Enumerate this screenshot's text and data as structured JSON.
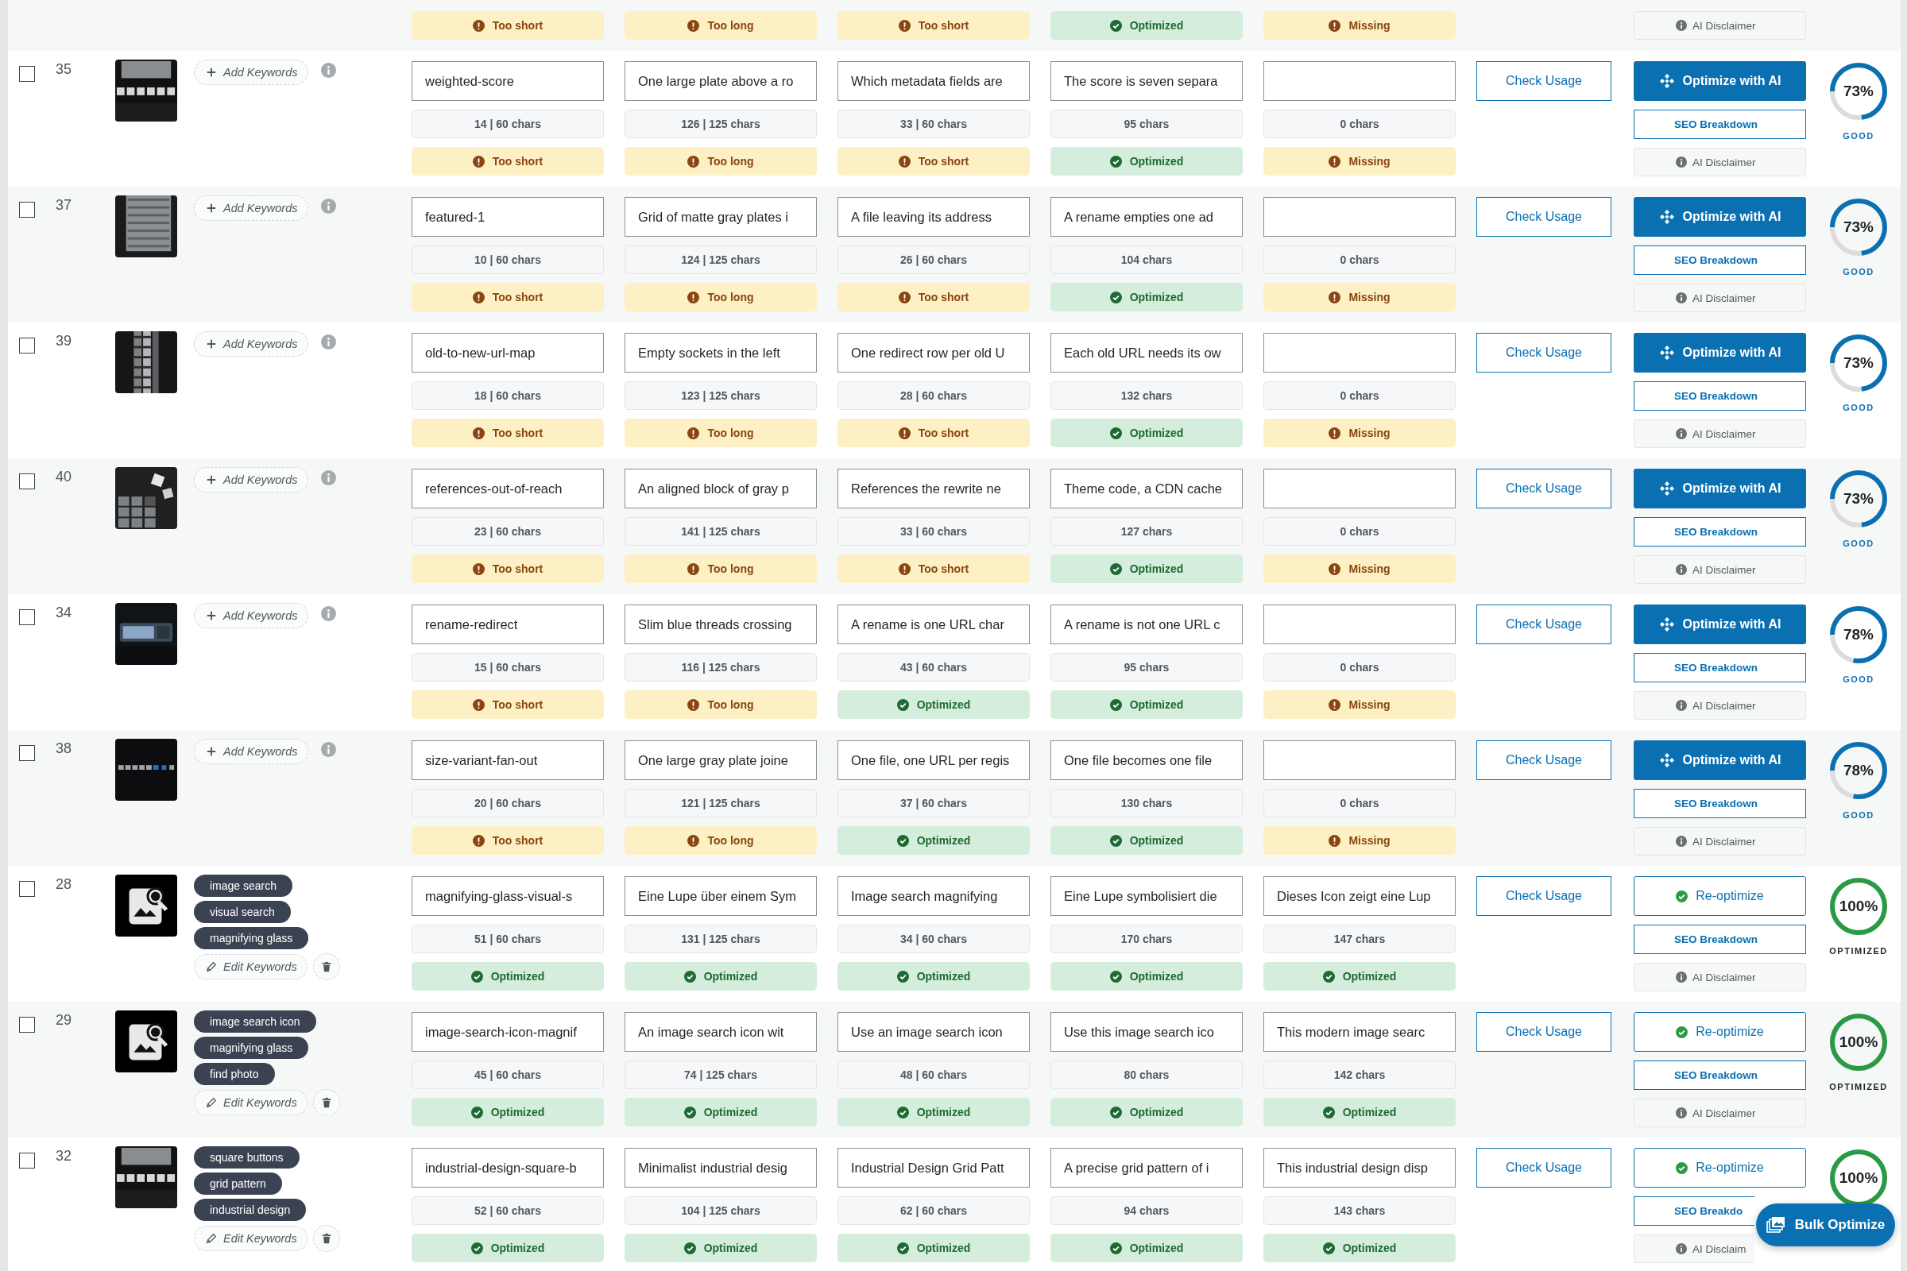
{
  "rows": [
    {
      "kind": "clipped",
      "fields": [
        {
          "status": {
            "kind": "warning",
            "text": "Too short"
          }
        },
        {
          "status": {
            "kind": "warning",
            "text": "Too long"
          }
        },
        {
          "status": {
            "kind": "warning",
            "text": "Too short"
          }
        },
        {
          "status": {
            "kind": "ok",
            "text": "Optimized"
          }
        },
        {
          "status": {
            "kind": "warning",
            "text": "Missing"
          }
        }
      ],
      "disclaimer": "AI Disclaimer"
    },
    {
      "kind": "full",
      "selected": false,
      "id": "35",
      "keywords": [],
      "keyword_action": "Add Keywords",
      "fields": [
        {
          "value": "weighted-score",
          "count": "14 | 60 chars",
          "status": {
            "kind": "warning",
            "text": "Too short"
          }
        },
        {
          "value": "One large plate above a ro",
          "count": "126 | 125 chars",
          "status": {
            "kind": "warning",
            "text": "Too long"
          }
        },
        {
          "value": "Which metadata fields are",
          "count": "33 | 60 chars",
          "status": {
            "kind": "warning",
            "text": "Too short"
          }
        },
        {
          "value": "The score is seven separa",
          "count": "95 chars",
          "status": {
            "kind": "ok",
            "text": "Optimized"
          }
        },
        {
          "count": "0 chars",
          "status": {
            "kind": "warning",
            "text": "Missing"
          }
        }
      ],
      "check_usage": "Check Usage",
      "optimize": {
        "kind": "ai",
        "label": "Optimize with AI"
      },
      "seo": "SEO Breakdown",
      "disclaimer": "AI Disclaimer",
      "score": {
        "kind": "good",
        "level": 0.73,
        "text": "73%",
        "label": "GOOD"
      }
    },
    {
      "kind": "full",
      "selected": false,
      "id": "37",
      "keywords": [],
      "keyword_action": "Add Keywords",
      "fields": [
        {
          "value": "featured-1",
          "count": "10 | 60 chars",
          "status": {
            "kind": "warning",
            "text": "Too short"
          }
        },
        {
          "value": "Grid of matte gray plates i",
          "count": "124 | 125 chars",
          "status": {
            "kind": "warning",
            "text": "Too long"
          }
        },
        {
          "value": "A file leaving its address",
          "count": "26 | 60 chars",
          "status": {
            "kind": "warning",
            "text": "Too short"
          }
        },
        {
          "value": "A rename empties one ad",
          "count": "104 chars",
          "status": {
            "kind": "ok",
            "text": "Optimized"
          }
        },
        {
          "count": "0 chars",
          "status": {
            "kind": "warning",
            "text": "Missing"
          }
        }
      ],
      "check_usage": "Check Usage",
      "optimize": {
        "kind": "ai",
        "label": "Optimize with AI"
      },
      "seo": "SEO Breakdown",
      "disclaimer": "AI Disclaimer",
      "score": {
        "kind": "good",
        "level": 0.73,
        "text": "73%",
        "label": "GOOD"
      }
    },
    {
      "kind": "full",
      "selected": false,
      "id": "39",
      "keywords": [],
      "keyword_action": "Add Keywords",
      "fields": [
        {
          "value": "old-to-new-url-map",
          "count": "18 | 60 chars",
          "status": {
            "kind": "warning",
            "text": "Too short"
          }
        },
        {
          "value": "Empty sockets in the left",
          "count": "123 | 125 chars",
          "status": {
            "kind": "warning",
            "text": "Too long"
          }
        },
        {
          "value": "One redirect row per old U",
          "count": "28 | 60 chars",
          "status": {
            "kind": "warning",
            "text": "Too short"
          }
        },
        {
          "value": "Each old URL needs its ow",
          "count": "132 chars",
          "status": {
            "kind": "ok",
            "text": "Optimized"
          }
        },
        {
          "count": "0 chars",
          "status": {
            "kind": "warning",
            "text": "Missing"
          }
        }
      ],
      "check_usage": "Check Usage",
      "optimize": {
        "kind": "ai",
        "label": "Optimize with AI"
      },
      "seo": "SEO Breakdown",
      "disclaimer": "AI Disclaimer",
      "score": {
        "kind": "good",
        "level": 0.73,
        "text": "73%",
        "label": "GOOD"
      }
    },
    {
      "kind": "full",
      "selected": false,
      "id": "40",
      "keywords": [],
      "keyword_action": "Add Keywords",
      "fields": [
        {
          "value": "references-out-of-reach",
          "count": "23 | 60 chars",
          "status": {
            "kind": "warning",
            "text": "Too short"
          }
        },
        {
          "value": "An aligned block of gray p",
          "count": "141 | 125 chars",
          "status": {
            "kind": "warning",
            "text": "Too long"
          }
        },
        {
          "value": "References the rewrite ne",
          "count": "33 | 60 chars",
          "status": {
            "kind": "warning",
            "text": "Too short"
          }
        },
        {
          "value": "Theme code, a CDN cache",
          "count": "127 chars",
          "status": {
            "kind": "ok",
            "text": "Optimized"
          }
        },
        {
          "count": "0 chars",
          "status": {
            "kind": "warning",
            "text": "Missing"
          }
        }
      ],
      "check_usage": "Check Usage",
      "optimize": {
        "kind": "ai",
        "label": "Optimize with AI"
      },
      "seo": "SEO Breakdown",
      "disclaimer": "AI Disclaimer",
      "score": {
        "kind": "good",
        "level": 0.73,
        "text": "73%",
        "label": "GOOD"
      }
    },
    {
      "kind": "full",
      "selected": false,
      "id": "34",
      "keywords": [],
      "keyword_action": "Add Keywords",
      "fields": [
        {
          "value": "rename-redirect",
          "count": "15 | 60 chars",
          "status": {
            "kind": "warning",
            "text": "Too short"
          }
        },
        {
          "value": "Slim blue threads crossing",
          "count": "116 | 125 chars",
          "status": {
            "kind": "warning",
            "text": "Too long"
          }
        },
        {
          "value": "A rename is one URL char",
          "count": "43 | 60 chars",
          "status": {
            "kind": "ok",
            "text": "Optimized"
          }
        },
        {
          "value": "A rename is not one URL c",
          "count": "95 chars",
          "status": {
            "kind": "ok",
            "text": "Optimized"
          }
        },
        {
          "count": "0 chars",
          "status": {
            "kind": "warning",
            "text": "Missing"
          }
        }
      ],
      "check_usage": "Check Usage",
      "optimize": {
        "kind": "ai",
        "label": "Optimize with AI"
      },
      "seo": "SEO Breakdown",
      "disclaimer": "AI Disclaimer",
      "score": {
        "kind": "good",
        "level": 0.78,
        "text": "78%",
        "label": "GOOD"
      }
    },
    {
      "kind": "full",
      "selected": false,
      "id": "38",
      "keywords": [],
      "keyword_action": "Add Keywords",
      "fields": [
        {
          "value": "size-variant-fan-out",
          "count": "20 | 60 chars",
          "status": {
            "kind": "warning",
            "text": "Too short"
          }
        },
        {
          "value": "One large gray plate joine",
          "count": "121 | 125 chars",
          "status": {
            "kind": "warning",
            "text": "Too long"
          }
        },
        {
          "value": "One file, one URL per regis",
          "count": "37 | 60 chars",
          "status": {
            "kind": "ok",
            "text": "Optimized"
          }
        },
        {
          "value": "One file becomes one file",
          "count": "130 chars",
          "status": {
            "kind": "ok",
            "text": "Optimized"
          }
        },
        {
          "count": "0 chars",
          "status": {
            "kind": "warning",
            "text": "Missing"
          }
        }
      ],
      "check_usage": "Check Usage",
      "optimize": {
        "kind": "ai",
        "label": "Optimize with AI"
      },
      "seo": "SEO Breakdown",
      "disclaimer": "AI Disclaimer",
      "score": {
        "kind": "good",
        "level": 0.78,
        "text": "78%",
        "label": "GOOD"
      }
    },
    {
      "kind": "full",
      "selected": false,
      "id": "28",
      "keywords": [
        "image search",
        "visual search",
        "magnifying glass"
      ],
      "keyword_action": "Edit Keywords",
      "fields": [
        {
          "value": "magnifying-glass-visual-s",
          "count": "51 | 60 chars",
          "status": {
            "kind": "ok",
            "text": "Optimized"
          }
        },
        {
          "value": "Eine Lupe über einem Sym",
          "count": "131 | 125 chars",
          "status": {
            "kind": "ok",
            "text": "Optimized"
          }
        },
        {
          "value": "Image search magnifying",
          "count": "34 | 60 chars",
          "status": {
            "kind": "ok",
            "text": "Optimized"
          }
        },
        {
          "value": "Eine Lupe symbolisiert die",
          "count": "170 chars",
          "status": {
            "kind": "ok",
            "text": "Optimized"
          }
        },
        {
          "value": "Dieses Icon zeigt eine Lup",
          "count": "147 chars",
          "status": {
            "kind": "ok",
            "text": "Optimized"
          }
        }
      ],
      "check_usage": "Check Usage",
      "optimize": {
        "kind": "redo",
        "label": "Re-optimize"
      },
      "seo": "SEO Breakdown",
      "disclaimer": "AI Disclaimer",
      "score": {
        "kind": "optimized",
        "level": 1,
        "text": "100%",
        "label": "OPTIMIZED"
      }
    },
    {
      "kind": "full",
      "selected": false,
      "id": "29",
      "keywords": [
        "image search icon",
        "magnifying glass",
        "find photo"
      ],
      "keyword_action": "Edit Keywords",
      "fields": [
        {
          "value": "image-search-icon-magnif",
          "count": "45 | 60 chars",
          "status": {
            "kind": "ok",
            "text": "Optimized"
          }
        },
        {
          "value": "An image search icon wit",
          "count": "74 | 125 chars",
          "status": {
            "kind": "ok",
            "text": "Optimized"
          }
        },
        {
          "value": "Use an image search icon",
          "count": "48 | 60 chars",
          "status": {
            "kind": "ok",
            "text": "Optimized"
          }
        },
        {
          "value": "Use this image search ico",
          "count": "80 chars",
          "status": {
            "kind": "ok",
            "text": "Optimized"
          }
        },
        {
          "value": "This modern image searc",
          "count": "142 chars",
          "status": {
            "kind": "ok",
            "text": "Optimized"
          }
        }
      ],
      "check_usage": "Check Usage",
      "optimize": {
        "kind": "redo",
        "label": "Re-optimize"
      },
      "seo": "SEO Breakdown",
      "disclaimer": "AI Disclaimer",
      "score": {
        "kind": "optimized",
        "level": 1,
        "text": "100%",
        "label": "OPTIMIZED"
      }
    },
    {
      "kind": "full",
      "selected": false,
      "id": "32",
      "keywords": [
        "square buttons",
        "grid pattern",
        "industrial design"
      ],
      "keyword_action": "Edit Keywords",
      "fields": [
        {
          "value": "industrial-design-square-b",
          "count": "52 | 60 chars",
          "status": {
            "kind": "ok",
            "text": "Optimized"
          }
        },
        {
          "value": "Minimalist industrial desig",
          "count": "104 | 125 chars",
          "status": {
            "kind": "ok",
            "text": "Optimized"
          }
        },
        {
          "value": "Industrial Design Grid Patt",
          "count": "62 | 60 chars",
          "status": {
            "kind": "ok",
            "text": "Optimized"
          }
        },
        {
          "value": "A precise grid pattern of i",
          "count": "94 chars",
          "status": {
            "kind": "ok",
            "text": "Optimized"
          }
        },
        {
          "value": "This industrial design disp",
          "count": "143 chars",
          "status": {
            "kind": "ok",
            "text": "Optimized"
          }
        }
      ],
      "check_usage": "Check Usage",
      "optimize": {
        "kind": "redo",
        "label": "Re-optimize"
      },
      "seo": "SEO Breakdo",
      "disclaimer": "AI Disclaim",
      "score": {
        "kind": "optimized",
        "level": 1,
        "text": "100%"
      }
    }
  ],
  "bulk_button": "Bulk Optimize"
}
